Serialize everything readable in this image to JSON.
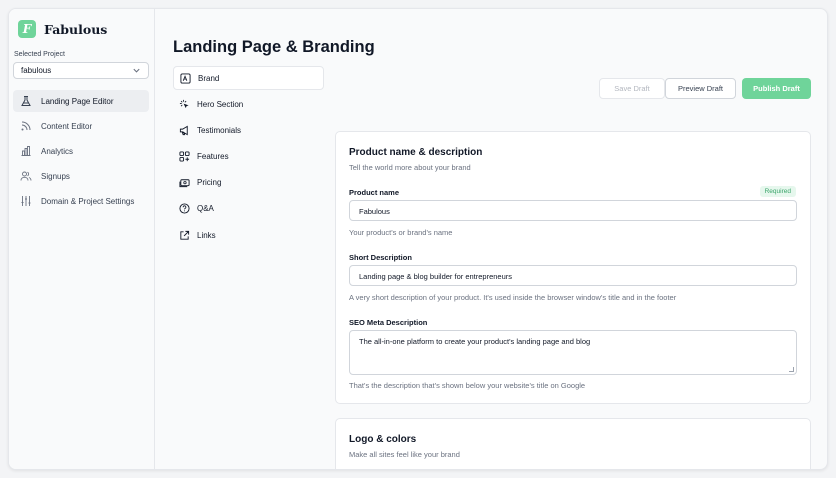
{
  "app": {
    "name": "Fabulous",
    "logo_letter": "F",
    "accent": "#6fd49a"
  },
  "sidebar": {
    "project_label": "Selected Project",
    "project_value": "fabulous",
    "items": [
      {
        "label": "Landing Page Editor",
        "icon": "flask-icon",
        "active": true
      },
      {
        "label": "Content Editor",
        "icon": "rss-icon",
        "active": false
      },
      {
        "label": "Analytics",
        "icon": "bar-chart-icon",
        "active": false
      },
      {
        "label": "Signups",
        "icon": "users-icon",
        "active": false
      },
      {
        "label": "Domain & Project Settings",
        "icon": "sliders-icon",
        "active": false
      }
    ]
  },
  "main": {
    "title": "Landing Page & Branding",
    "subnav": [
      {
        "label": "Brand",
        "icon": "brand-icon",
        "active": true
      },
      {
        "label": "Hero Section",
        "icon": "cursor-click-icon",
        "active": false
      },
      {
        "label": "Testimonials",
        "icon": "megaphone-icon",
        "active": false
      },
      {
        "label": "Features",
        "icon": "grid-plus-icon",
        "active": false
      },
      {
        "label": "Pricing",
        "icon": "cash-icon",
        "active": false
      },
      {
        "label": "Q&A",
        "icon": "question-icon",
        "active": false
      },
      {
        "label": "Links",
        "icon": "external-link-icon",
        "active": false
      }
    ],
    "actions": {
      "save": "Save Draft",
      "preview": "Preview Draft",
      "publish": "Publish Draft"
    },
    "product_card": {
      "title": "Product name & description",
      "subtitle": "Tell the world more about your brand",
      "name_label": "Product name",
      "required_badge": "Required",
      "name_value": "Fabulous",
      "name_help": "Your product's or brand's name",
      "short_label": "Short Description",
      "short_value": "Landing page & blog builder for entrepreneurs",
      "short_help": "A very short description of your product. It's used inside the browser window's title and in the footer",
      "seo_label": "SEO Meta Description",
      "seo_value": "The all-in-one platform to create your product's landing page and blog",
      "seo_help": "That's the description that's shown below your website's title on Google"
    },
    "logo_card": {
      "title": "Logo & colors",
      "subtitle": "Make all sites feel like your brand"
    }
  }
}
